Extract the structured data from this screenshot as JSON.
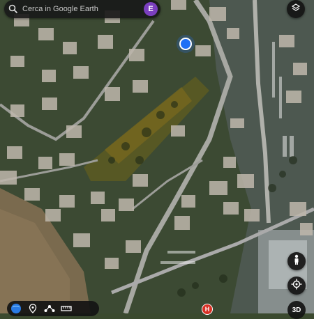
{
  "search": {
    "placeholder": "Cerca in Google Earth"
  },
  "account": {
    "initial": "E",
    "color": "#7b3fbf"
  },
  "buttons": {
    "layers_icon": "layers-icon",
    "pegman_icon": "pegman-icon",
    "compass_icon": "location-target-icon",
    "three_d_label": "3D"
  },
  "map": {
    "marker_label": "H",
    "location_dot_color": "#1e6ff5"
  },
  "bottom_toolbar": {
    "icons": [
      "globe-icon",
      "place-pin-icon",
      "path-icon",
      "ruler-icon"
    ]
  }
}
